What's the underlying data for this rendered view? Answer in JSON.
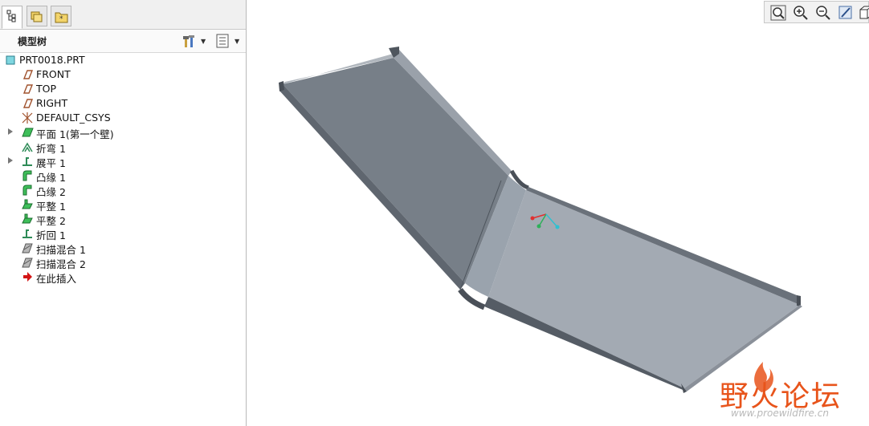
{
  "model_tree": {
    "title": "模型树",
    "items": [
      {
        "label": "PRT0018.PRT",
        "icon": "part-icon",
        "expandable": false,
        "indent": 0
      },
      {
        "label": "FRONT",
        "icon": "datum-plane-icon",
        "expandable": false,
        "indent": 1
      },
      {
        "label": "TOP",
        "icon": "datum-plane-icon",
        "expandable": false,
        "indent": 1
      },
      {
        "label": "RIGHT",
        "icon": "datum-plane-icon",
        "expandable": false,
        "indent": 1
      },
      {
        "label": "DEFAULT_CSYS",
        "icon": "csys-icon",
        "expandable": false,
        "indent": 1
      },
      {
        "label": "平面 1(第一个壁)",
        "icon": "planar-wall-icon",
        "expandable": true,
        "indent": 1
      },
      {
        "label": "折弯 1",
        "icon": "bend-icon",
        "expandable": false,
        "indent": 1
      },
      {
        "label": "展平 1",
        "icon": "unbend-icon",
        "expandable": true,
        "indent": 1
      },
      {
        "label": "凸缘 1",
        "icon": "flange-icon",
        "expandable": false,
        "indent": 1
      },
      {
        "label": "凸缘 2",
        "icon": "flange-icon",
        "expandable": false,
        "indent": 1
      },
      {
        "label": "平整 1",
        "icon": "flat-wall-icon",
        "expandable": false,
        "indent": 1
      },
      {
        "label": "平整 2",
        "icon": "flat-wall-icon",
        "expandable": false,
        "indent": 1
      },
      {
        "label": "折回 1",
        "icon": "bend-back-icon",
        "expandable": false,
        "indent": 1
      },
      {
        "label": "扫描混合 1",
        "icon": "swept-blend-icon",
        "expandable": false,
        "indent": 1
      },
      {
        "label": "扫描混合 2",
        "icon": "swept-blend-icon",
        "expandable": false,
        "indent": 1
      },
      {
        "label": "在此插入",
        "icon": "insert-here-arrow-icon",
        "expandable": false,
        "indent": 1
      }
    ]
  },
  "tabs": [
    {
      "name": "model-tree-tab",
      "icon": "model-tree-icon",
      "active": true
    },
    {
      "name": "folder-browser-tab",
      "icon": "folder-browser-icon",
      "active": false
    },
    {
      "name": "favorites-tab",
      "icon": "favorites-folder-icon",
      "active": false
    }
  ],
  "watermark": {
    "text": "野火论坛",
    "url": "www.proewildfire.cn"
  },
  "colors": {
    "accent_orange": "#e8541b",
    "part_fill": "#8b929b",
    "part_light": "#a3aab3",
    "part_dark": "#5d646d"
  }
}
